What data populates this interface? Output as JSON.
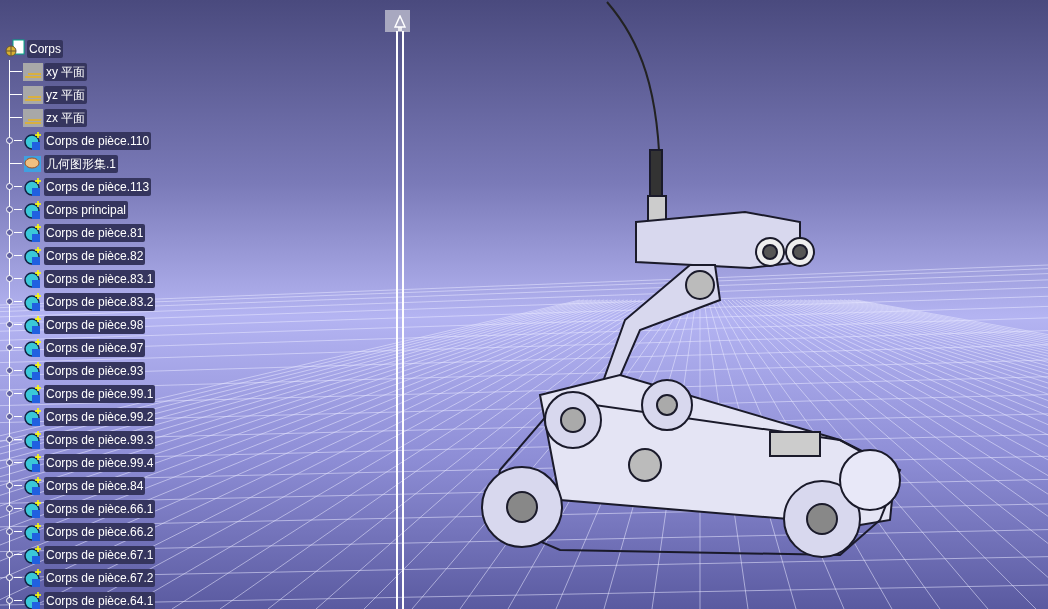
{
  "tree": {
    "root": {
      "label": "Corps",
      "children": [
        {
          "kind": "plane",
          "label": "xy 平面",
          "expandable": false
        },
        {
          "kind": "plane",
          "label": "yz 平面",
          "expandable": false
        },
        {
          "kind": "plane",
          "label": "zx 平面",
          "expandable": false
        },
        {
          "kind": "body",
          "label": "Corps de pièce.110",
          "expandable": true
        },
        {
          "kind": "geomset",
          "label": "几何图形集.1",
          "expandable": false
        },
        {
          "kind": "body",
          "label": "Corps de pièce.113",
          "expandable": true
        },
        {
          "kind": "body",
          "label": "Corps principal",
          "expandable": true
        },
        {
          "kind": "body",
          "label": "Corps de pièce.81",
          "expandable": true
        },
        {
          "kind": "body",
          "label": "Corps de pièce.82",
          "expandable": true
        },
        {
          "kind": "body",
          "label": "Corps de pièce.83.1",
          "expandable": true
        },
        {
          "kind": "body",
          "label": "Corps de pièce.83.2",
          "expandable": true
        },
        {
          "kind": "body",
          "label": "Corps de pièce.98",
          "expandable": true
        },
        {
          "kind": "body",
          "label": "Corps de pièce.97",
          "expandable": true
        },
        {
          "kind": "body",
          "label": "Corps de pièce.93",
          "expandable": true
        },
        {
          "kind": "body",
          "label": "Corps de pièce.99.1",
          "expandable": true
        },
        {
          "kind": "body",
          "label": "Corps de pièce.99.2",
          "expandable": true
        },
        {
          "kind": "body",
          "label": "Corps de pièce.99.3",
          "expandable": true
        },
        {
          "kind": "body",
          "label": "Corps de pièce.99.4",
          "expandable": true
        },
        {
          "kind": "body",
          "label": "Corps de pièce.84",
          "expandable": true
        },
        {
          "kind": "body",
          "label": "Corps de pièce.66.1",
          "expandable": true
        },
        {
          "kind": "body",
          "label": "Corps de pièce.66.2",
          "expandable": true
        },
        {
          "kind": "body",
          "label": "Corps de pièce.67.1",
          "expandable": true
        },
        {
          "kind": "body",
          "label": "Corps de pièce.67.2",
          "expandable": true
        },
        {
          "kind": "body",
          "label": "Corps de pièce.64.1",
          "expandable": true
        }
      ]
    }
  }
}
